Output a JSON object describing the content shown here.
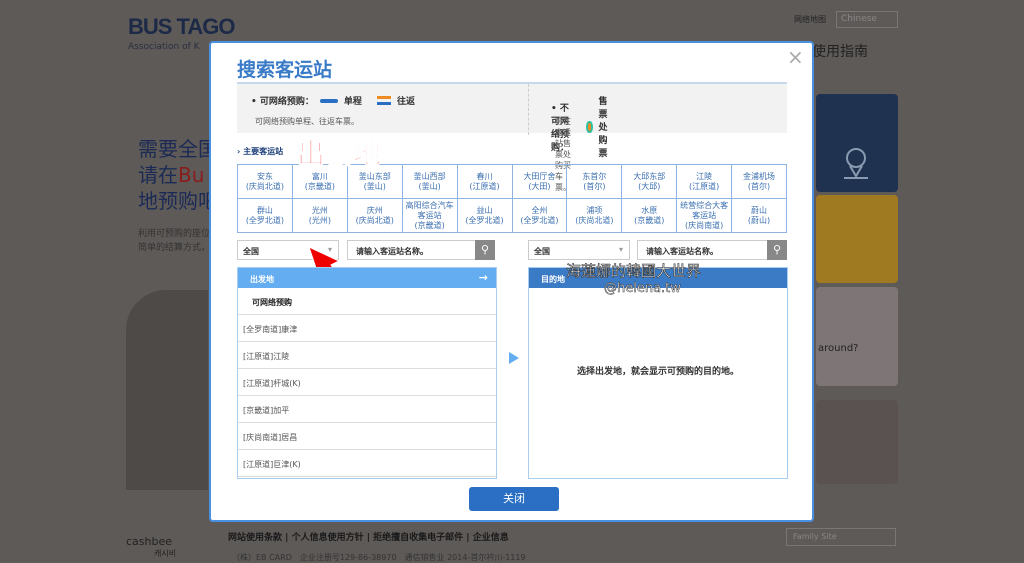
{
  "background": {
    "logo": "BUS TAGO",
    "logo_sub": "Association of K",
    "top_link": "网络地图",
    "language": "Chinese",
    "guide": "使用指南",
    "hero_1": "需要全国",
    "hero_2a": "请在",
    "hero_2b": "Bu",
    "hero_3": "地预购吧",
    "hero_sub_1": "利用可预购的座位",
    "hero_sub_2": "简单的结算方式，",
    "footer_links": [
      "网站使用条款",
      "个人信息使用方针",
      "拒绝擅自收集电子邮件",
      "企业信息"
    ],
    "footer_addr": "（株）EB CARD　企业注册号129-86-38970　通信销售业 2014-首尔衿川-1119",
    "family_site": "Family Site",
    "cashbee": "cashbee",
    "cashbee_kr": "캐시비",
    "tile_text": "around?"
  },
  "modal": {
    "title": "搜索客运站",
    "close_icon": "×",
    "info": {
      "online_label": "• 可网络预购：",
      "oneway": "单程",
      "roundtrip": "往返",
      "online_desc": "可网络预购单程、往返车票。",
      "offline_label": "• 不可网络预购：",
      "booth": "售票处购票",
      "offline_desc": "可在客运站售票处购买车票。"
    },
    "main_stations_label": "主要客运站",
    "overlay_label": "出發地",
    "stations": [
      [
        "安东",
        "(庆尚北道)"
      ],
      [
        "富川",
        "(京畿道)"
      ],
      [
        "釜山东部",
        "(釜山)"
      ],
      [
        "釜山西部",
        "(釜山)"
      ],
      [
        "春川",
        "(江原道)"
      ],
      [
        "大田厅舍",
        "(大田)"
      ],
      [
        "东首尔",
        "(首尔)"
      ],
      [
        "大邱东部",
        "(大邱)"
      ],
      [
        "江陵",
        "(江原道)"
      ],
      [
        "金浦机场",
        "(首尔)"
      ],
      [
        "群山",
        "(全罗北道)"
      ],
      [
        "光州",
        "(光州)"
      ],
      [
        "庆州",
        "(庆尚北道)"
      ],
      [
        "高阳综合汽车",
        "客运站",
        "(京畿道)"
      ],
      [
        "益山",
        "(全罗北道)"
      ],
      [
        "全州",
        "(全罗北道)"
      ],
      [
        "浦项",
        "(庆尚北道)"
      ],
      [
        "水原",
        "(京畿道)"
      ],
      [
        "统营综合大客",
        "客运站",
        "(庆尚南道)"
      ],
      [
        "蔚山",
        "(蔚山)"
      ]
    ],
    "departure": {
      "region": "全国",
      "search_placeholder": "请输入客运站名称。",
      "header": "出发地",
      "group": "可网络预购",
      "items": [
        "[全罗南道]康津",
        "[江原道]江陵",
        "[江原道]杆城(K)",
        "[京畿道]加平",
        "[庆尚南道]居昌",
        "[江原道]巨津(K)"
      ]
    },
    "destination": {
      "region": "全国",
      "search_placeholder": "请输入客运站名称。",
      "header": "目的地",
      "empty_message": "选择出发地，就会显示可预购的目的地。"
    },
    "watermark": "海蓮娜的韓國大世界",
    "watermark_handle": "@helena.tw",
    "close_button": "关闭"
  },
  "colors": {
    "accent": "#3a7bc8",
    "departure_header": "#63adf0",
    "destination_header": "#3b7ac4",
    "button": "#2a6fc4"
  }
}
